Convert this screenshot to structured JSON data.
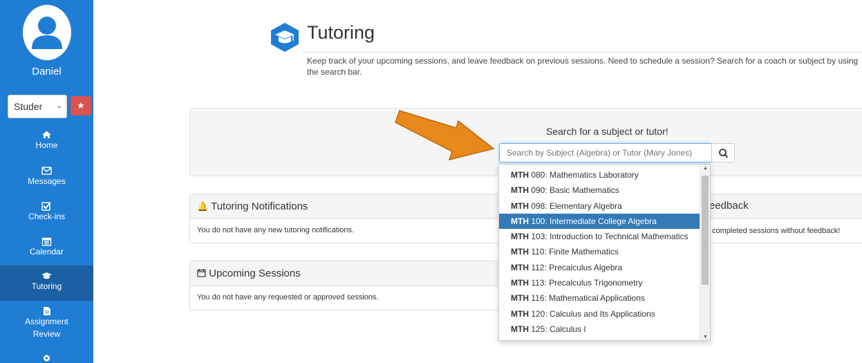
{
  "sidebar": {
    "username": "Daniel",
    "role": "Studer",
    "items": [
      {
        "label": "Home",
        "icon": "home-icon"
      },
      {
        "label": "Messages",
        "icon": "envelope-icon"
      },
      {
        "label": "Check-ins",
        "icon": "check-square-icon"
      },
      {
        "label": "Calendar",
        "icon": "calendar-icon"
      },
      {
        "label": "Tutoring",
        "icon": "graduation-cap-icon",
        "active": true
      },
      {
        "label": "Assignment",
        "label2": "Review",
        "icon": "file-icon"
      }
    ]
  },
  "header": {
    "title": "Tutoring",
    "description": "Keep track of your upcoming sessions, and leave feedback on previous sessions. Need to schedule a session? Search for a coach or subject by using the search bar."
  },
  "search": {
    "heading": "Search for a subject or tutor!",
    "placeholder": "Search by Subject (Algebra) or Tutor (Mary Jones)"
  },
  "panels": {
    "notifications": {
      "title": "Tutoring Notifications",
      "body": "You do not have any new tutoring notifications."
    },
    "upcoming": {
      "title": "Upcoming Sessions",
      "body": "You do not have any requested or approved sessions."
    },
    "feedback": {
      "title_fragment": "eedback",
      "body_fragment": "completed sessions without feedback!"
    }
  },
  "dropdown": {
    "items": [
      {
        "code": "MTH",
        "rest": " 080: Mathematics Laboratory"
      },
      {
        "code": "MTH",
        "rest": " 090: Basic Mathematics"
      },
      {
        "code": "MTH",
        "rest": " 098: Elementary Algebra"
      },
      {
        "code": "MTH",
        "rest": " 100: Intermediate College Algebra",
        "selected": true
      },
      {
        "code": "MTH",
        "rest": " 103: Introduction to Technical Mathematics"
      },
      {
        "code": "MTH",
        "rest": " 110: Finite Mathematics"
      },
      {
        "code": "MTH",
        "rest": " 112: Precalculus Algebra"
      },
      {
        "code": "MTH",
        "rest": " 113: Precalculus Trigonometry"
      },
      {
        "code": "MTH",
        "rest": " 116: Mathematical Applications"
      },
      {
        "code": "MTH",
        "rest": " 120: Calculus and Its Applications"
      },
      {
        "code": "MTH",
        "rest": " 125: Calculus I"
      }
    ]
  },
  "colors": {
    "sidebar": "#1f7dd4",
    "sidebar_active": "#1a5fa3",
    "selected": "#337ab7",
    "arrow": "#e8891b"
  }
}
